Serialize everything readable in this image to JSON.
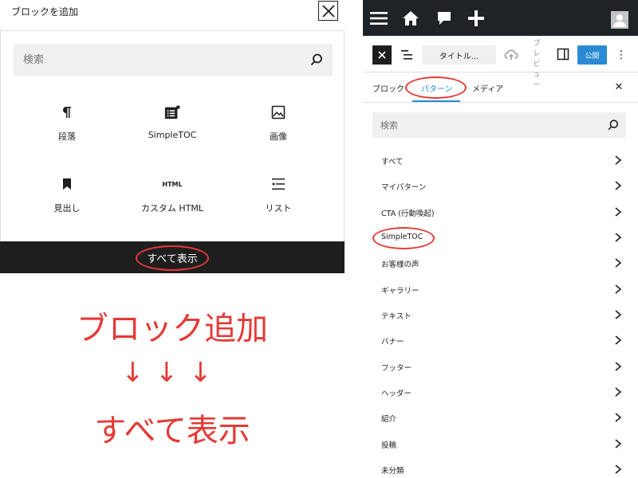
{
  "left_panel": {
    "title": "ブロックを追加",
    "search_placeholder": "検索",
    "blocks": [
      {
        "label": "段落",
        "icon": "pilcrow-icon"
      },
      {
        "label": "SimpleTOC",
        "icon": "toc-icon"
      },
      {
        "label": "画像",
        "icon": "image-icon"
      },
      {
        "label": "見出し",
        "icon": "bookmark-icon"
      },
      {
        "label": "カスタム HTML",
        "icon": "html-icon",
        "icon_text": "HTML"
      },
      {
        "label": "リスト",
        "icon": "list-icon"
      }
    ],
    "show_all_label": "すべて表示"
  },
  "annotation": {
    "line1": "ブロック追加",
    "line2": "↓↓↓",
    "line3": "すべて表示",
    "color": "#e53935"
  },
  "right_panel": {
    "toolbar": {
      "title_button": "タイトル...",
      "preview_label": "プレビュー",
      "publish_label": "公開"
    },
    "tabs": [
      {
        "label": "ブロック",
        "active": false
      },
      {
        "label": "パターン",
        "active": true
      },
      {
        "label": "メディア",
        "active": false
      }
    ],
    "search_placeholder": "検索",
    "categories": [
      "すべて",
      "マイパターン",
      "CTA (行動喚起)",
      "SimpleTOC",
      "お客様の声",
      "ギャラリー",
      "テキスト",
      "バナー",
      "フッター",
      "ヘッダー",
      "紹介",
      "投稿",
      "未分類"
    ],
    "colors": {
      "admin_bar": "#1d2327",
      "accent": "#2a8ad4",
      "highlight": "#e53935"
    }
  }
}
